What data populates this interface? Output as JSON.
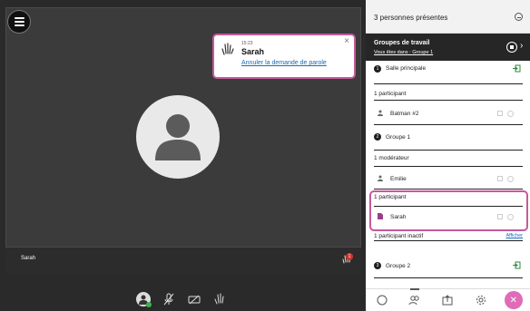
{
  "video": {
    "participant_name": "Sarah",
    "raise_hand_count": "1"
  },
  "notification": {
    "time": "15:23",
    "name": "Sarah",
    "link_text": "Annuler la demande de parole",
    "close": "×"
  },
  "panel": {
    "header_title": "3 personnes présentes",
    "groups_title": "Groupes de travail",
    "groups_subtitle": "Vous êtes dans : Groupe 1",
    "main_room": "Salle principale",
    "main_room_count": "1 participant",
    "main_room_user": "Batman #2",
    "group1_badge": "2",
    "group1": "Groupe 1",
    "group1_moderator_label": "1 modérateur",
    "group1_moderator": "Emilie",
    "group1_participant_label": "1 participant",
    "group1_participant": "Sarah",
    "inactive_label": "1 participant inactif",
    "inactive_action": "Afficher",
    "group2_badge": "3",
    "group2": "Groupe 2"
  },
  "colors": {
    "highlight": "#c45a9a",
    "accent_link": "#1a6ab8",
    "close_button": "#e06bb8"
  }
}
